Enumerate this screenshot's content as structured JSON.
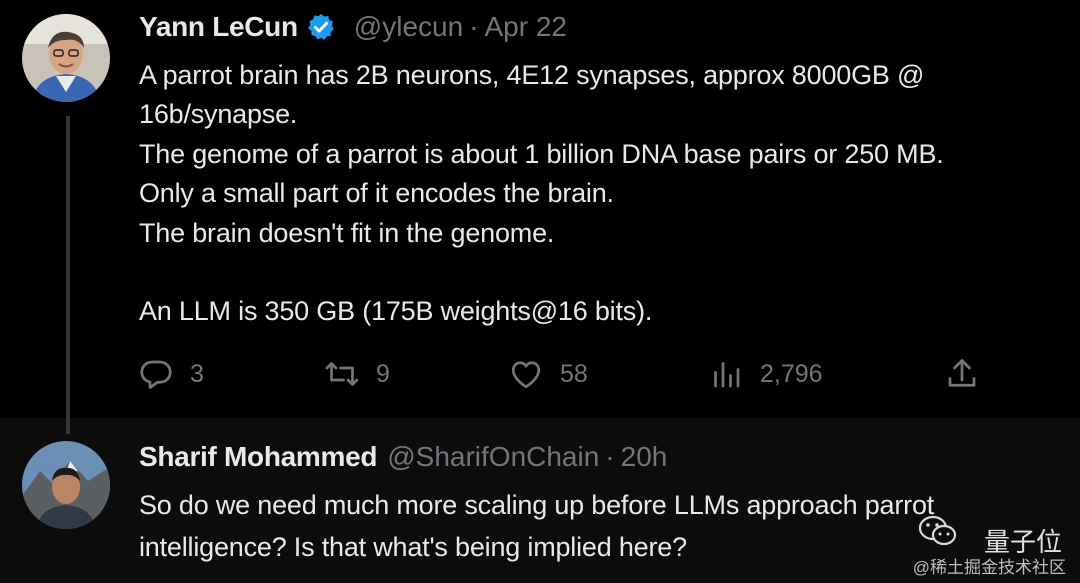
{
  "tweet1": {
    "name": "Yann LeCun",
    "handle": "@ylecun",
    "separator": "·",
    "time": "Apr 22",
    "lines": [
      "A parrot brain has 2B neurons, 4E12 synapses, approx 8000GB @",
      "16b/synapse.",
      "The genome of a parrot is about 1 billion DNA base pairs or 250 MB.",
      "Only a small part of it encodes the brain.",
      "The brain doesn't fit in the genome.",
      "An LLM is 350 GB (175B weights@16 bits)."
    ],
    "actions": {
      "replies": "3",
      "retweets": "9",
      "likes": "58",
      "views": "2,796"
    }
  },
  "tweet2": {
    "name": "Sharif Mohammed",
    "handle": "@SharifOnChain",
    "separator": "·",
    "time": "20h",
    "lines": [
      "So do we need much more scaling up before LLMs approach parrot",
      "intelligence? Is that what's being implied here?"
    ]
  },
  "watermark": {
    "name": "量子位",
    "sub": "@稀土掘金技术社区"
  },
  "icons": [
    "verified-badge-icon",
    "reply-icon",
    "retweet-icon",
    "like-icon",
    "views-icon",
    "share-icon",
    "wechat-icon"
  ],
  "colors": {
    "background": "#000000",
    "text": "#e7e9ea",
    "muted": "#71767b",
    "verified": "#1d9bf0"
  }
}
